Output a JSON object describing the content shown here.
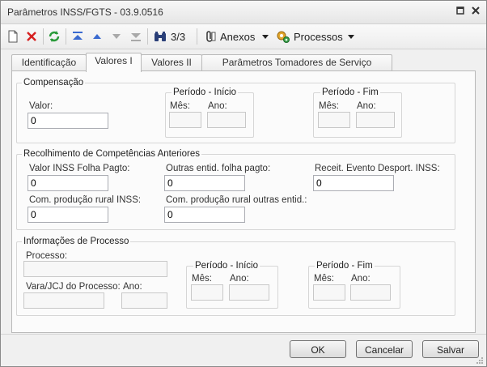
{
  "window": {
    "title": "Parâmetros INSS/FGTS - 03.9.0516"
  },
  "toolbar": {
    "record_counter": "3/3",
    "anexos_label": "Anexos",
    "processos_label": "Processos"
  },
  "tabs": [
    {
      "label": "Identificação"
    },
    {
      "label": "Valores I"
    },
    {
      "label": "Valores II"
    },
    {
      "label": "Parâmetros Tomadores de Serviço"
    }
  ],
  "compensacao": {
    "title": "Compensação",
    "valor_label": "Valor:",
    "valor_value": "0",
    "periodo_inicio": {
      "title": "Período - Início",
      "mes_label": "Mês:",
      "ano_label": "Ano:",
      "mes_value": "",
      "ano_value": ""
    },
    "periodo_fim": {
      "title": "Período - Fim",
      "mes_label": "Mês:",
      "ano_label": "Ano:",
      "mes_value": "",
      "ano_value": ""
    }
  },
  "recolhimento": {
    "title": "Recolhimento de Competências Anteriores",
    "valor_inss_label": "Valor INSS Folha Pagto:",
    "valor_inss_value": "0",
    "outras_entid_label": "Outras entid. folha pagto:",
    "outras_entid_value": "0",
    "receit_evento_label": "Receit. Evento Desport. INSS:",
    "receit_evento_value": "0",
    "com_prod_rural_label": "Com. produção rural INSS:",
    "com_prod_rural_value": "0",
    "com_prod_rural_outras_label": "Com. produção rural outras entid.:",
    "com_prod_rural_outras_value": "0"
  },
  "processo": {
    "title": "Informações de Processo",
    "processo_label": "Processo:",
    "processo_value": "",
    "vara_label": "Vara/JCJ do Processo:",
    "vara_value": "",
    "ano_label": "Ano:",
    "ano_value": "",
    "periodo_inicio": {
      "title": "Período - Início",
      "mes_label": "Mês:",
      "ano_label": "Ano:",
      "mes_value": "",
      "ano_value": ""
    },
    "periodo_fim": {
      "title": "Período - Fim",
      "mes_label": "Mês:",
      "ano_label": "Ano:",
      "mes_value": "",
      "ano_value": ""
    }
  },
  "footer": {
    "ok_label": "OK",
    "cancelar_label": "Cancelar",
    "salvar_label": "Salvar"
  }
}
